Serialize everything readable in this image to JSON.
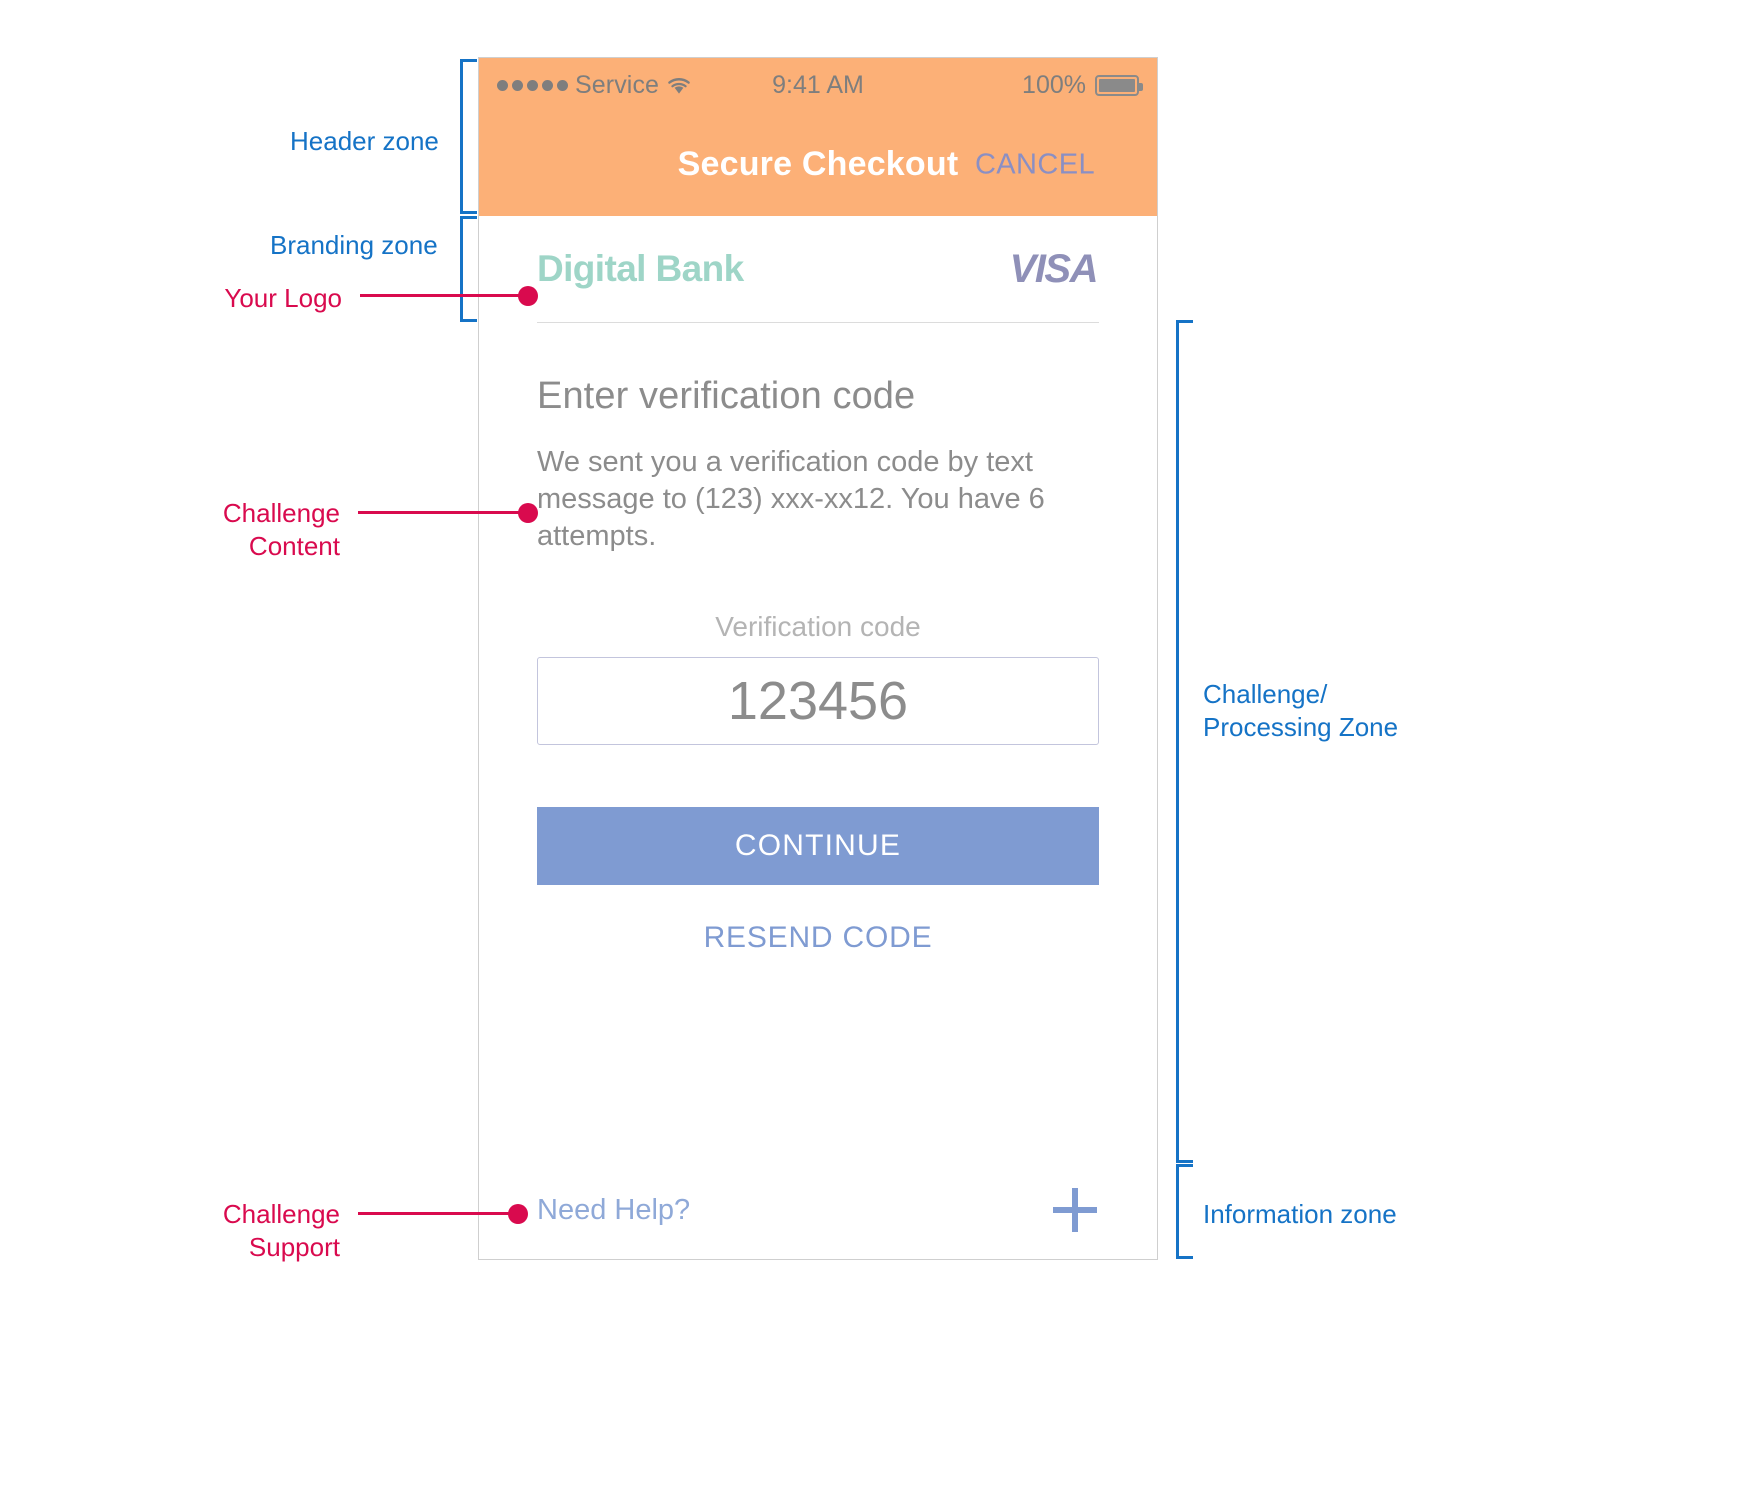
{
  "phone": {
    "status_bar": {
      "signal_dots": 5,
      "carrier": "Service",
      "wifi_icon": "wifi-icon",
      "time": "9:41 AM",
      "battery_percent": "100%",
      "battery_icon": "battery-full-icon"
    },
    "nav": {
      "title": "Secure Checkout",
      "cancel_label": "CANCEL"
    },
    "branding": {
      "logo_text": "Digital Bank",
      "network_logo": "VISA"
    },
    "challenge": {
      "title": "Enter verification code",
      "body": "We sent you a verification code by text message to (123) xxx-xx12. You have 6 attempts.",
      "field_label": "Verification code",
      "field_placeholder": "123456",
      "field_value": "",
      "continue_label": "CONTINUE",
      "resend_label": "RESEND CODE"
    },
    "information": {
      "help_label": "Need Help?",
      "expand_icon": "plus-icon"
    }
  },
  "annotations": {
    "header_zone": "Header zone",
    "branding_zone": "Branding zone",
    "your_logo": "Your Logo",
    "challenge_content": "Challenge\nContent",
    "challenge_support": "Challenge\nSupport",
    "challenge_processing_zone": "Challenge/\nProcessing Zone",
    "information_zone": "Information zone"
  },
  "colors": {
    "header_orange": "#fcb077",
    "brand_teal": "#9ed5c7",
    "visa_purple": "#8f90b8",
    "action_blue": "#7f9bd2",
    "annotation_blue": "#1573c6",
    "annotation_pink": "#d90a4e"
  }
}
